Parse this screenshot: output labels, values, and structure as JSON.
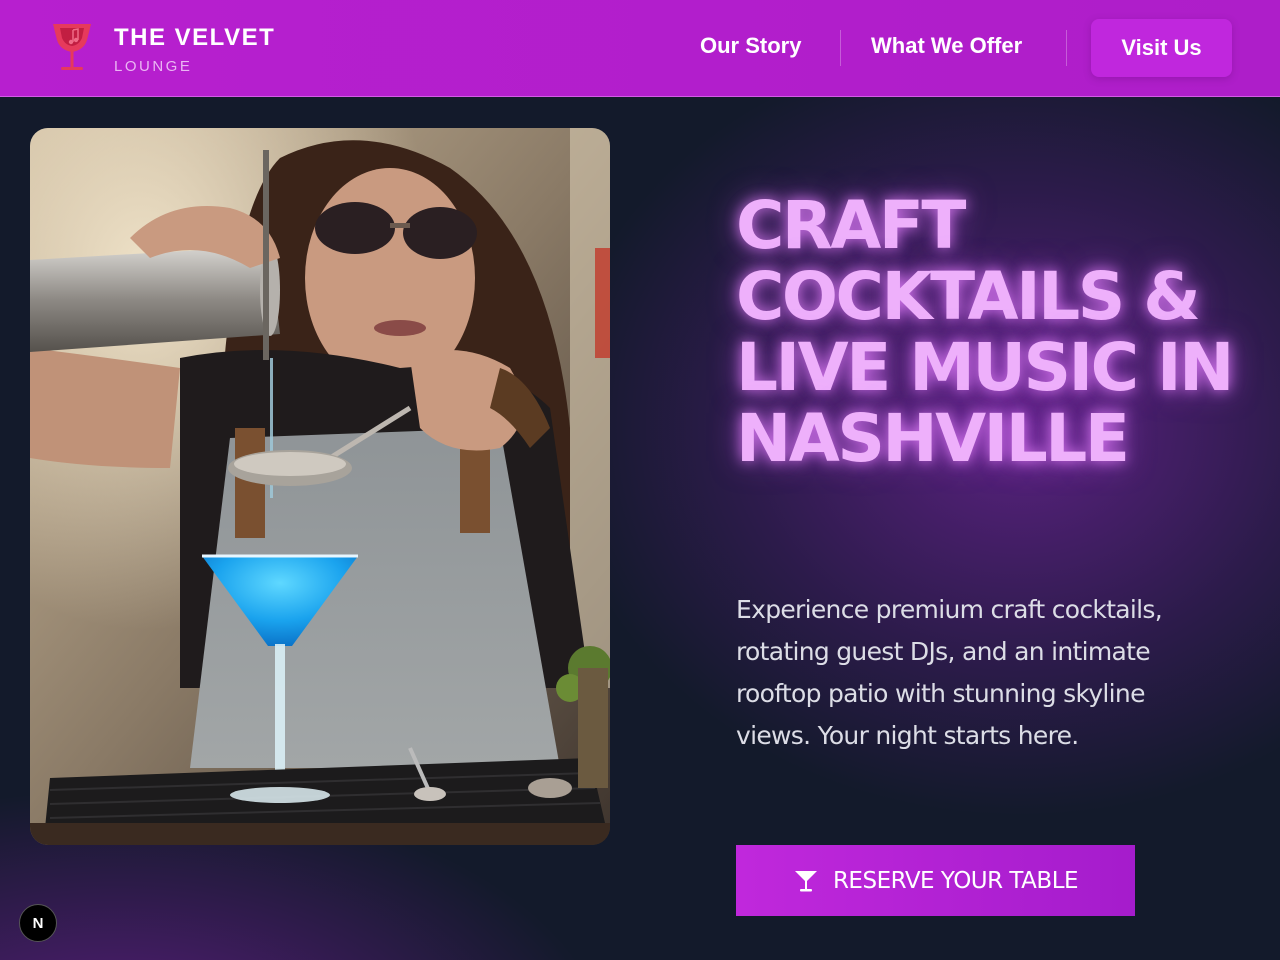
{
  "brand": {
    "title": "THE VELVET",
    "subtitle": "LOUNGE",
    "logo_icon": "wine-glass-icon",
    "logo_color": "#e63a5c"
  },
  "nav": {
    "items": [
      {
        "label": "Our Story"
      },
      {
        "label": "What We Offer"
      }
    ],
    "cta_label": "Visit Us"
  },
  "hero": {
    "image_subject": "bartender pouring blue martini",
    "headline": "CRAFT COCKTAILS & LIVE MUSIC IN NASHVILLE",
    "description": "Experience premium craft cocktails, rotating guest DJs, and an intimate rooftop patio with stunning skyline views. Your night starts here.",
    "cta_label": "RESERVE YOUR TABLE",
    "cta_icon": "cocktail-glass-icon"
  },
  "badge": {
    "label": "N"
  },
  "colors": {
    "header_bg": "#b71fcf",
    "accent_button": "#c027dd",
    "headline_text": "#eeb0fb",
    "page_bg": "#131a2b"
  }
}
